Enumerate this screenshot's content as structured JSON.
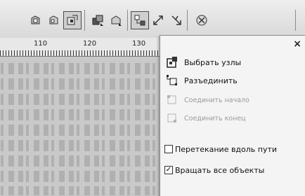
{
  "toolbar": {
    "icons": [
      "node-tool-icon",
      "node-tool-icon",
      "convert-node-icon",
      "shape-icon",
      "shape-icon",
      "select-nodes-icon",
      "expand-nodes-icon",
      "reduce-nodes-icon",
      "target-icon"
    ]
  },
  "ruler": {
    "labels": [
      "110",
      "120",
      "130"
    ]
  },
  "menu": {
    "close": "×",
    "items": [
      {
        "label": "Выбрать узлы",
        "enabled": true
      },
      {
        "label": "Разъединить",
        "enabled": true
      },
      {
        "label": "Соединить начало",
        "enabled": false
      },
      {
        "label": "Соединить конец",
        "enabled": false
      }
    ],
    "options": [
      {
        "label": "Перетекание вдоль пути",
        "checked": false
      },
      {
        "label": "Вращать все объекты",
        "checked": true
      }
    ],
    "check_mark": "✓"
  },
  "colors": {
    "background": "#c9c9c9",
    "toolbar": "#e3e3e3",
    "menu": "#f4f4f4",
    "disabled_text": "#9a9a9a"
  }
}
